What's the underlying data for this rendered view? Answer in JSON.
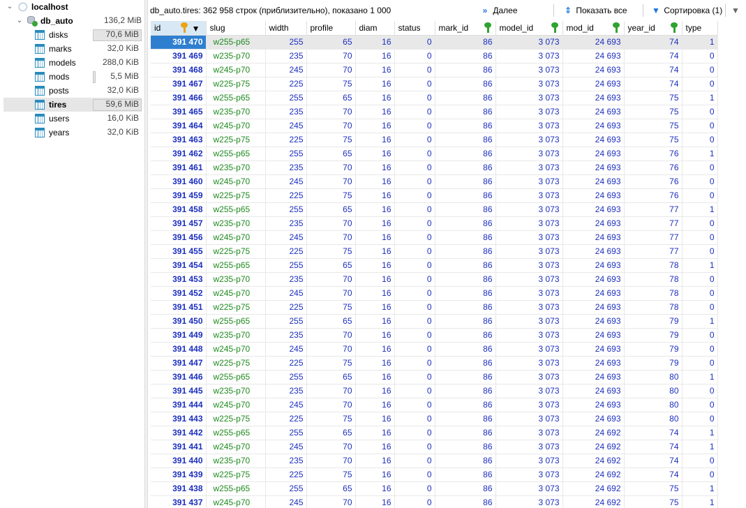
{
  "tree": {
    "host": {
      "label": "localhost"
    },
    "db": {
      "label": "db_auto",
      "size": "136,2 MiB"
    },
    "tables": [
      {
        "label": "disks",
        "size": "70,6 MiB",
        "fill": 1.0
      },
      {
        "label": "marks",
        "size": "32,0 KiB",
        "fill": 0
      },
      {
        "label": "models",
        "size": "288,0 KiB",
        "fill": 0
      },
      {
        "label": "mods",
        "size": "5,5 MiB",
        "fill": 0.05
      },
      {
        "label": "posts",
        "size": "32,0 KiB",
        "fill": 0
      },
      {
        "label": "tires",
        "size": "59,6 MiB",
        "fill": 1.0,
        "selected": true
      },
      {
        "label": "users",
        "size": "16,0 KiB",
        "fill": 0
      },
      {
        "label": "years",
        "size": "32,0 KiB",
        "fill": 0
      }
    ]
  },
  "topbar": {
    "status": "db_auto.tires: 362 958 строк (приблизительно), показано 1 000",
    "next_label": "Далее",
    "show_all_label": "Показать все",
    "sort_label": "Сортировка (1)"
  },
  "grid": {
    "columns": [
      "id",
      "slug",
      "width",
      "profile",
      "diam",
      "status",
      "mark_id",
      "model_id",
      "mod_id",
      "year_id",
      "type"
    ],
    "rows": [
      [
        "391 470",
        "w255-p65",
        "255",
        "65",
        "16",
        "0",
        "86",
        "3 073",
        "24 693",
        "74",
        "1"
      ],
      [
        "391 469",
        "w235-p70",
        "235",
        "70",
        "16",
        "0",
        "86",
        "3 073",
        "24 693",
        "74",
        "0"
      ],
      [
        "391 468",
        "w245-p70",
        "245",
        "70",
        "16",
        "0",
        "86",
        "3 073",
        "24 693",
        "74",
        "0"
      ],
      [
        "391 467",
        "w225-p75",
        "225",
        "75",
        "16",
        "0",
        "86",
        "3 073",
        "24 693",
        "74",
        "0"
      ],
      [
        "391 466",
        "w255-p65",
        "255",
        "65",
        "16",
        "0",
        "86",
        "3 073",
        "24 693",
        "75",
        "1"
      ],
      [
        "391 465",
        "w235-p70",
        "235",
        "70",
        "16",
        "0",
        "86",
        "3 073",
        "24 693",
        "75",
        "0"
      ],
      [
        "391 464",
        "w245-p70",
        "245",
        "70",
        "16",
        "0",
        "86",
        "3 073",
        "24 693",
        "75",
        "0"
      ],
      [
        "391 463",
        "w225-p75",
        "225",
        "75",
        "16",
        "0",
        "86",
        "3 073",
        "24 693",
        "75",
        "0"
      ],
      [
        "391 462",
        "w255-p65",
        "255",
        "65",
        "16",
        "0",
        "86",
        "3 073",
        "24 693",
        "76",
        "1"
      ],
      [
        "391 461",
        "w235-p70",
        "235",
        "70",
        "16",
        "0",
        "86",
        "3 073",
        "24 693",
        "76",
        "0"
      ],
      [
        "391 460",
        "w245-p70",
        "245",
        "70",
        "16",
        "0",
        "86",
        "3 073",
        "24 693",
        "76",
        "0"
      ],
      [
        "391 459",
        "w225-p75",
        "225",
        "75",
        "16",
        "0",
        "86",
        "3 073",
        "24 693",
        "76",
        "0"
      ],
      [
        "391 458",
        "w255-p65",
        "255",
        "65",
        "16",
        "0",
        "86",
        "3 073",
        "24 693",
        "77",
        "1"
      ],
      [
        "391 457",
        "w235-p70",
        "235",
        "70",
        "16",
        "0",
        "86",
        "3 073",
        "24 693",
        "77",
        "0"
      ],
      [
        "391 456",
        "w245-p70",
        "245",
        "70",
        "16",
        "0",
        "86",
        "3 073",
        "24 693",
        "77",
        "0"
      ],
      [
        "391 455",
        "w225-p75",
        "225",
        "75",
        "16",
        "0",
        "86",
        "3 073",
        "24 693",
        "77",
        "0"
      ],
      [
        "391 454",
        "w255-p65",
        "255",
        "65",
        "16",
        "0",
        "86",
        "3 073",
        "24 693",
        "78",
        "1"
      ],
      [
        "391 453",
        "w235-p70",
        "235",
        "70",
        "16",
        "0",
        "86",
        "3 073",
        "24 693",
        "78",
        "0"
      ],
      [
        "391 452",
        "w245-p70",
        "245",
        "70",
        "16",
        "0",
        "86",
        "3 073",
        "24 693",
        "78",
        "0"
      ],
      [
        "391 451",
        "w225-p75",
        "225",
        "75",
        "16",
        "0",
        "86",
        "3 073",
        "24 693",
        "78",
        "0"
      ],
      [
        "391 450",
        "w255-p65",
        "255",
        "65",
        "16",
        "0",
        "86",
        "3 073",
        "24 693",
        "79",
        "1"
      ],
      [
        "391 449",
        "w235-p70",
        "235",
        "70",
        "16",
        "0",
        "86",
        "3 073",
        "24 693",
        "79",
        "0"
      ],
      [
        "391 448",
        "w245-p70",
        "245",
        "70",
        "16",
        "0",
        "86",
        "3 073",
        "24 693",
        "79",
        "0"
      ],
      [
        "391 447",
        "w225-p75",
        "225",
        "75",
        "16",
        "0",
        "86",
        "3 073",
        "24 693",
        "79",
        "0"
      ],
      [
        "391 446",
        "w255-p65",
        "255",
        "65",
        "16",
        "0",
        "86",
        "3 073",
        "24 693",
        "80",
        "1"
      ],
      [
        "391 445",
        "w235-p70",
        "235",
        "70",
        "16",
        "0",
        "86",
        "3 073",
        "24 693",
        "80",
        "0"
      ],
      [
        "391 444",
        "w245-p70",
        "245",
        "70",
        "16",
        "0",
        "86",
        "3 073",
        "24 693",
        "80",
        "0"
      ],
      [
        "391 443",
        "w225-p75",
        "225",
        "75",
        "16",
        "0",
        "86",
        "3 073",
        "24 693",
        "80",
        "0"
      ],
      [
        "391 442",
        "w255-p65",
        "255",
        "65",
        "16",
        "0",
        "86",
        "3 073",
        "24 692",
        "74",
        "1"
      ],
      [
        "391 441",
        "w245-p70",
        "245",
        "70",
        "16",
        "0",
        "86",
        "3 073",
        "24 692",
        "74",
        "1"
      ],
      [
        "391 440",
        "w235-p70",
        "235",
        "70",
        "16",
        "0",
        "86",
        "3 073",
        "24 692",
        "74",
        "0"
      ],
      [
        "391 439",
        "w225-p75",
        "225",
        "75",
        "16",
        "0",
        "86",
        "3 073",
        "24 692",
        "74",
        "0"
      ],
      [
        "391 438",
        "w255-p65",
        "255",
        "65",
        "16",
        "0",
        "86",
        "3 073",
        "24 692",
        "75",
        "1"
      ],
      [
        "391 437",
        "w245-p70",
        "245",
        "70",
        "16",
        "0",
        "86",
        "3 073",
        "24 692",
        "75",
        "1"
      ]
    ]
  },
  "colors": {
    "accent": "#2f7fd1",
    "number": "#1c2fbf",
    "text_value": "#1e8a1e",
    "primary_key": "#e8a317",
    "foreign_key": "#2fa32f"
  }
}
